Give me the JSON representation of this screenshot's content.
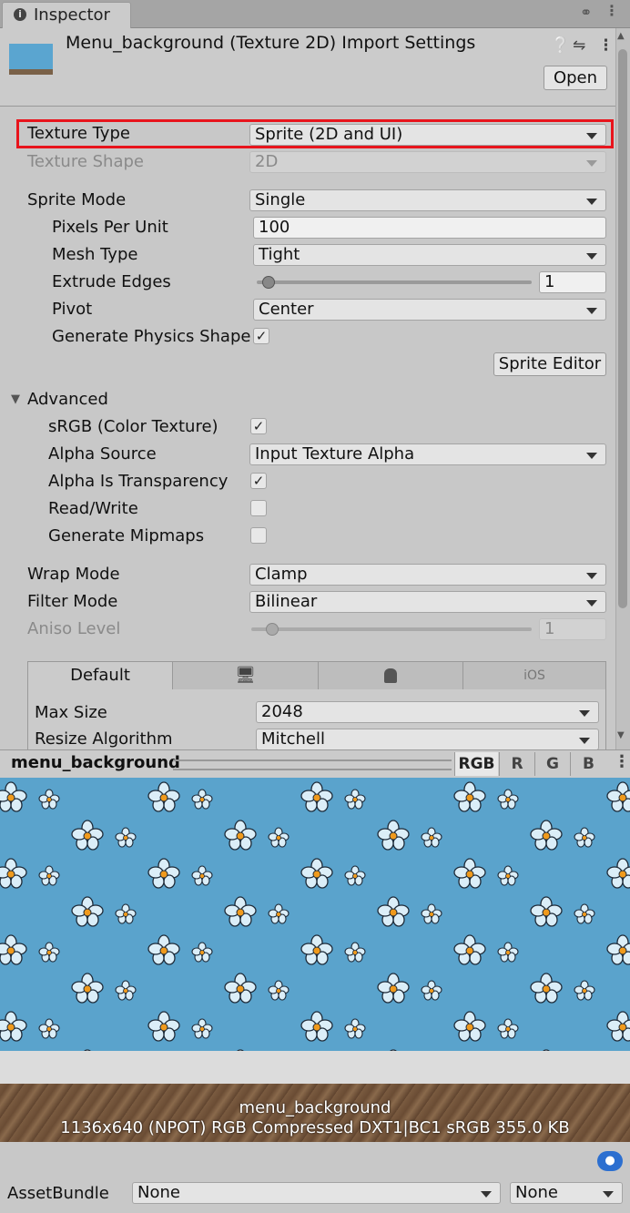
{
  "tab": {
    "label": "Inspector"
  },
  "header": {
    "title": "Menu_background (Texture 2D) Import Settings",
    "open_label": "Open"
  },
  "fields": {
    "texture_type": {
      "label": "Texture Type",
      "value": "Sprite (2D and UI)"
    },
    "texture_shape": {
      "label": "Texture Shape",
      "value": "2D"
    },
    "sprite_mode": {
      "label": "Sprite Mode",
      "value": "Single"
    },
    "pixels_per_unit": {
      "label": "Pixels Per Unit",
      "value": "100"
    },
    "mesh_type": {
      "label": "Mesh Type",
      "value": "Tight"
    },
    "extrude_edges": {
      "label": "Extrude Edges",
      "value": "1"
    },
    "pivot": {
      "label": "Pivot",
      "value": "Center"
    },
    "generate_physics_shape": {
      "label": "Generate Physics Shape",
      "checked": true
    },
    "sprite_editor_label": "Sprite Editor",
    "advanced": {
      "label": "Advanced"
    },
    "srgb": {
      "label": "sRGB (Color Texture)",
      "checked": true
    },
    "alpha_source": {
      "label": "Alpha Source",
      "value": "Input Texture Alpha"
    },
    "alpha_is_transparency": {
      "label": "Alpha Is Transparency",
      "checked": true
    },
    "read_write": {
      "label": "Read/Write",
      "checked": false
    },
    "generate_mipmaps": {
      "label": "Generate Mipmaps",
      "checked": false
    },
    "wrap_mode": {
      "label": "Wrap Mode",
      "value": "Clamp"
    },
    "filter_mode": {
      "label": "Filter Mode",
      "value": "Bilinear"
    },
    "aniso_level": {
      "label": "Aniso Level",
      "value": "1"
    }
  },
  "platform_tabs": {
    "default": "Default",
    "ios": "iOS"
  },
  "platform_fields": {
    "max_size": {
      "label": "Max Size",
      "value": "2048"
    },
    "resize_algorithm": {
      "label": "Resize Algorithm",
      "value": "Mitchell"
    }
  },
  "preview": {
    "name": "menu_background",
    "channels": [
      "RGB",
      "R",
      "G",
      "B"
    ],
    "info_name": "menu_background",
    "info_details": "1136x640 (NPOT)  RGB Compressed DXT1|BC1 sRGB   355.0 KB"
  },
  "asset_bundle": {
    "label": "AssetBundle",
    "name_value": "None",
    "variant_value": "None"
  },
  "colors": {
    "highlight": "#e8141c",
    "preview_bg": "#5aa3cc",
    "tag_icon": "#2c6fd0"
  }
}
